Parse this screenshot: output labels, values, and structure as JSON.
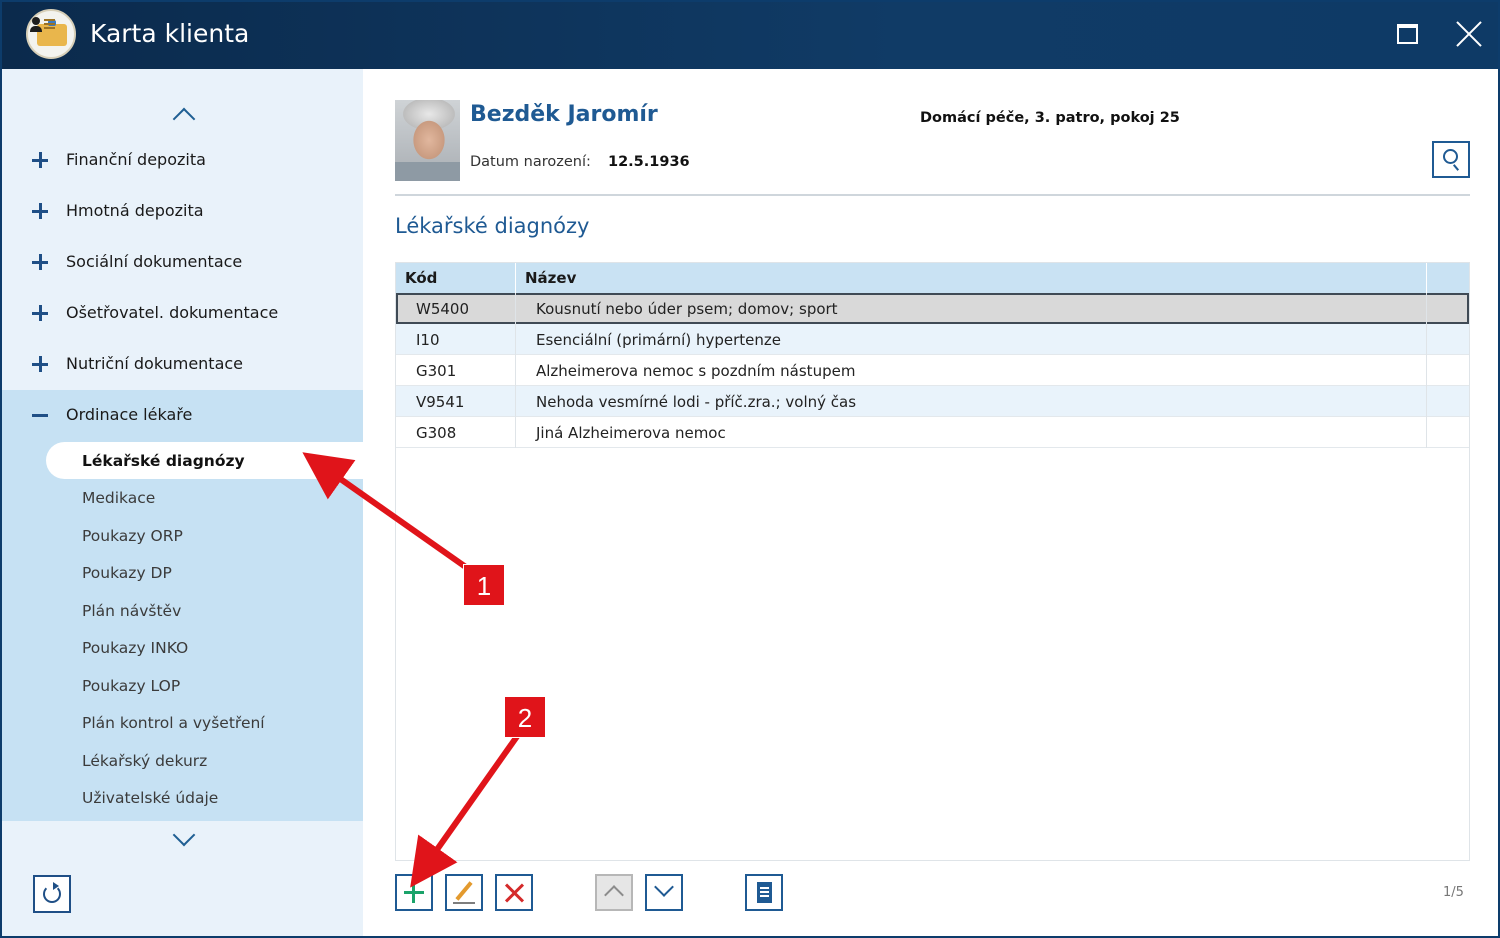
{
  "window": {
    "title": "Karta klienta",
    "icons": {
      "app": "client-card-icon",
      "maximize": "maximize-icon",
      "close": "close-icon"
    }
  },
  "sidebar": {
    "items": [
      {
        "label": "Finanční depozita",
        "icon": "plus-icon"
      },
      {
        "label": "Hmotná depozita",
        "icon": "plus-icon"
      },
      {
        "label": "Sociální dokumentace",
        "icon": "plus-icon"
      },
      {
        "label": "Ošetřovatel. dokumentace",
        "icon": "plus-icon"
      },
      {
        "label": "Nutriční dokumentace",
        "icon": "plus-icon"
      },
      {
        "label": "Ordinace lékaře",
        "icon": "minus-icon"
      }
    ],
    "subitems": [
      {
        "label": "Lékařské diagnózy",
        "active": true
      },
      {
        "label": "Medikace"
      },
      {
        "label": "Poukazy ORP"
      },
      {
        "label": "Poukazy DP"
      },
      {
        "label": "Plán návštěv"
      },
      {
        "label": "Poukazy INKO"
      },
      {
        "label": "Poukazy LOP"
      },
      {
        "label": "Plán kontrol a vyšetření"
      },
      {
        "label": "Lékařský dekurz"
      },
      {
        "label": "Uživatelské údaje"
      }
    ]
  },
  "client": {
    "name": "Bezděk Jaromír",
    "dob_label": "Datum narození:",
    "dob_value": "12.5.1936",
    "location": "Domácí péče, 3. patro, pokoj 25"
  },
  "section": {
    "title": "Lékařské diagnózy"
  },
  "table": {
    "columns": [
      "Kód",
      "Název"
    ],
    "rows": [
      {
        "code": "W5400",
        "name": "Kousnutí nebo úder psem; domov; sport",
        "selected": true
      },
      {
        "code": "I10",
        "name": "Esenciální (primární) hypertenze"
      },
      {
        "code": "G301",
        "name": "Alzheimerova nemoc s pozdním nástupem"
      },
      {
        "code": "V9541",
        "name": "Nehoda vesmírné lodi - příč.zra.; volný čas"
      },
      {
        "code": "G308",
        "name": "Jiná Alzheimerova nemoc"
      }
    ]
  },
  "toolbar": {
    "pager": "1/5",
    "icons": [
      "add-icon",
      "edit-icon",
      "delete-icon",
      "move-up-icon",
      "move-down-icon",
      "document-icon"
    ]
  },
  "annotations": {
    "badge1": "1",
    "badge2": "2",
    "color": "#e0141a"
  },
  "colors": {
    "titlebar": "#0b2a4c",
    "accent": "#1f5a93",
    "sidebar": "#e9f2fa",
    "sidebar_open": "#c6e1f3",
    "table_header": "#c9e2f3"
  }
}
